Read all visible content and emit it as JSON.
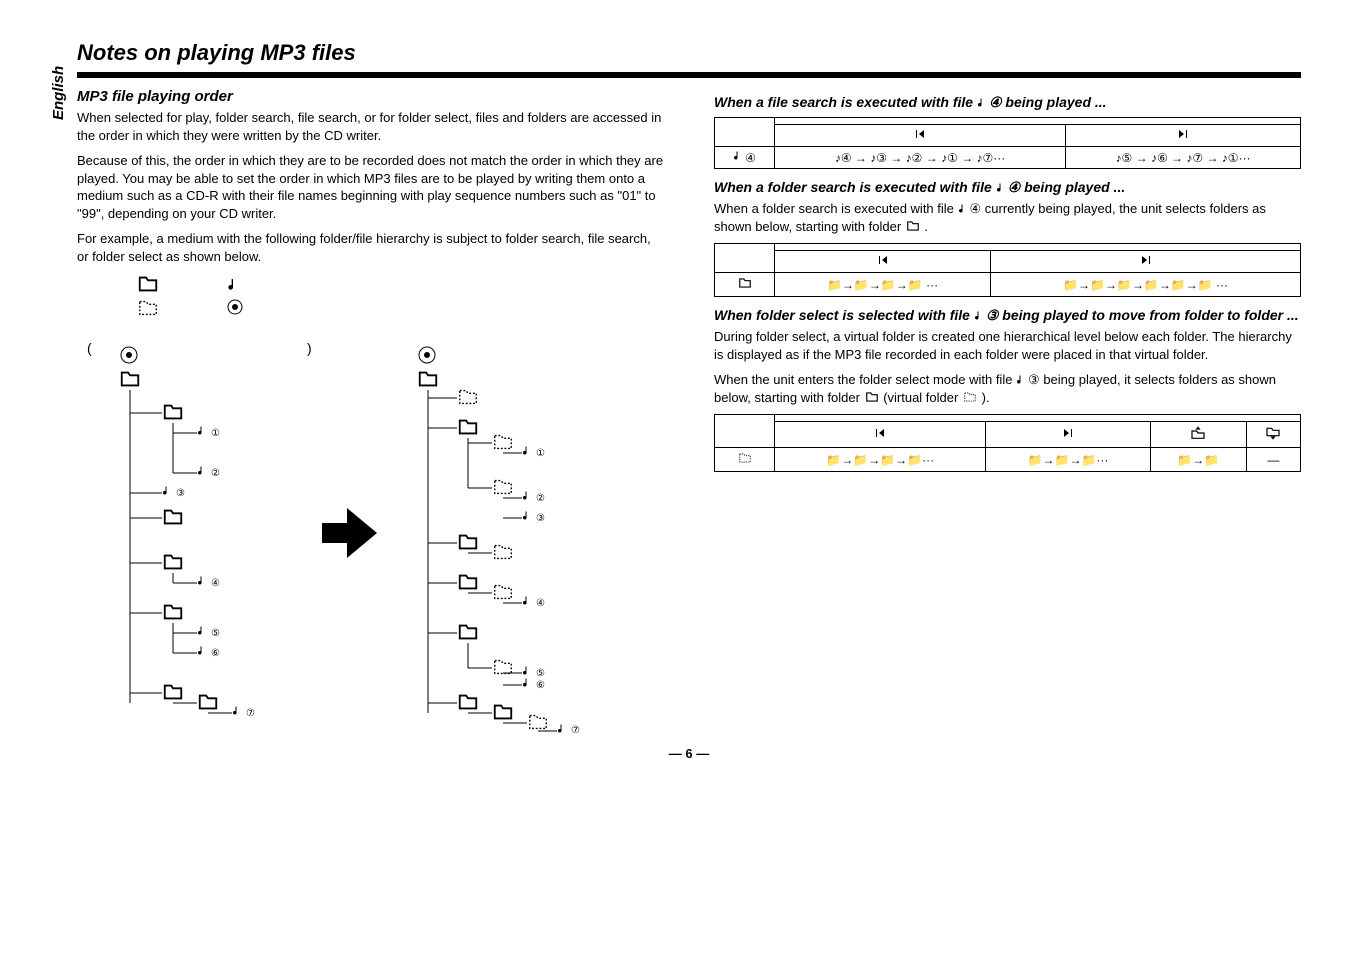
{
  "language": "English",
  "main_heading": "Notes on playing MP3 files",
  "left": {
    "sub_heading": "MP3 file playing order",
    "p1": "When selected for play, folder search, file search, or for folder select, files and folders are accessed in the order in which they were written by the CD writer.",
    "p2": "Because of this, the order in which they are to be recorded does not match the order in which they are played. You may be able to set the order in which MP3 files are to be played by writing them onto a medium such as a CD-R with their file names beginning with play sequence numbers such as \"01\" to \"99\", depending on your CD writer.",
    "p3": "For example, a medium with the following folder/file hierarchy is subject to folder search, file search, or folder select as shown below."
  },
  "right": {
    "s1_title_a": "When a file search is executed with file ",
    "s1_title_b": "  being played ...",
    "table1": {
      "col_prev": "♪④ → ♪③ → ♪② → ♪① → ♪⑦···",
      "col_next": "♪⑤ → ♪⑥ → ♪⑦ → ♪①···",
      "row_label": "④"
    },
    "s2_title_a": "When a folder search is executed with file ",
    "s2_title_b": "  being played ...",
    "s2_p_a": "When a folder search is executed with file ",
    "s2_p_b": "④  currently being played, the unit selects folders as shown below, starting with folder ",
    "s2_p_c": " .",
    "s3_title_a": "When folder select is selected with file ",
    "s3_title_b": "  being played to move from folder to folder ...",
    "s3_p_a": "During folder select, a virtual folder is created one hierarchical level below each folder. The hierarchy is displayed as if the MP3 file recorded in each folder were placed in that virtual folder.",
    "s3_p_b_a": "When the unit enters the folder select mode with file ",
    "s3_p_b_b": "③  being played, it selects folders as shown below, starting with folder ",
    "s3_p_b_c": " (virtual folder ",
    "s3_p_b_d": " ).",
    "t2_prev_seq": "📁→📁→📁→📁 ···",
    "t2_next_seq": "📁→📁→📁→📁→📁→📁 ···",
    "t3_prev_seq": "📁→📁→📁→📁···",
    "t3_next_seq": "📁→📁→📁···",
    "t3_up_seq": "📁→📁",
    "t3_down_seq": "—"
  },
  "circled": {
    "c3": "③",
    "c4": "④"
  },
  "pagenum": "— 6 —"
}
